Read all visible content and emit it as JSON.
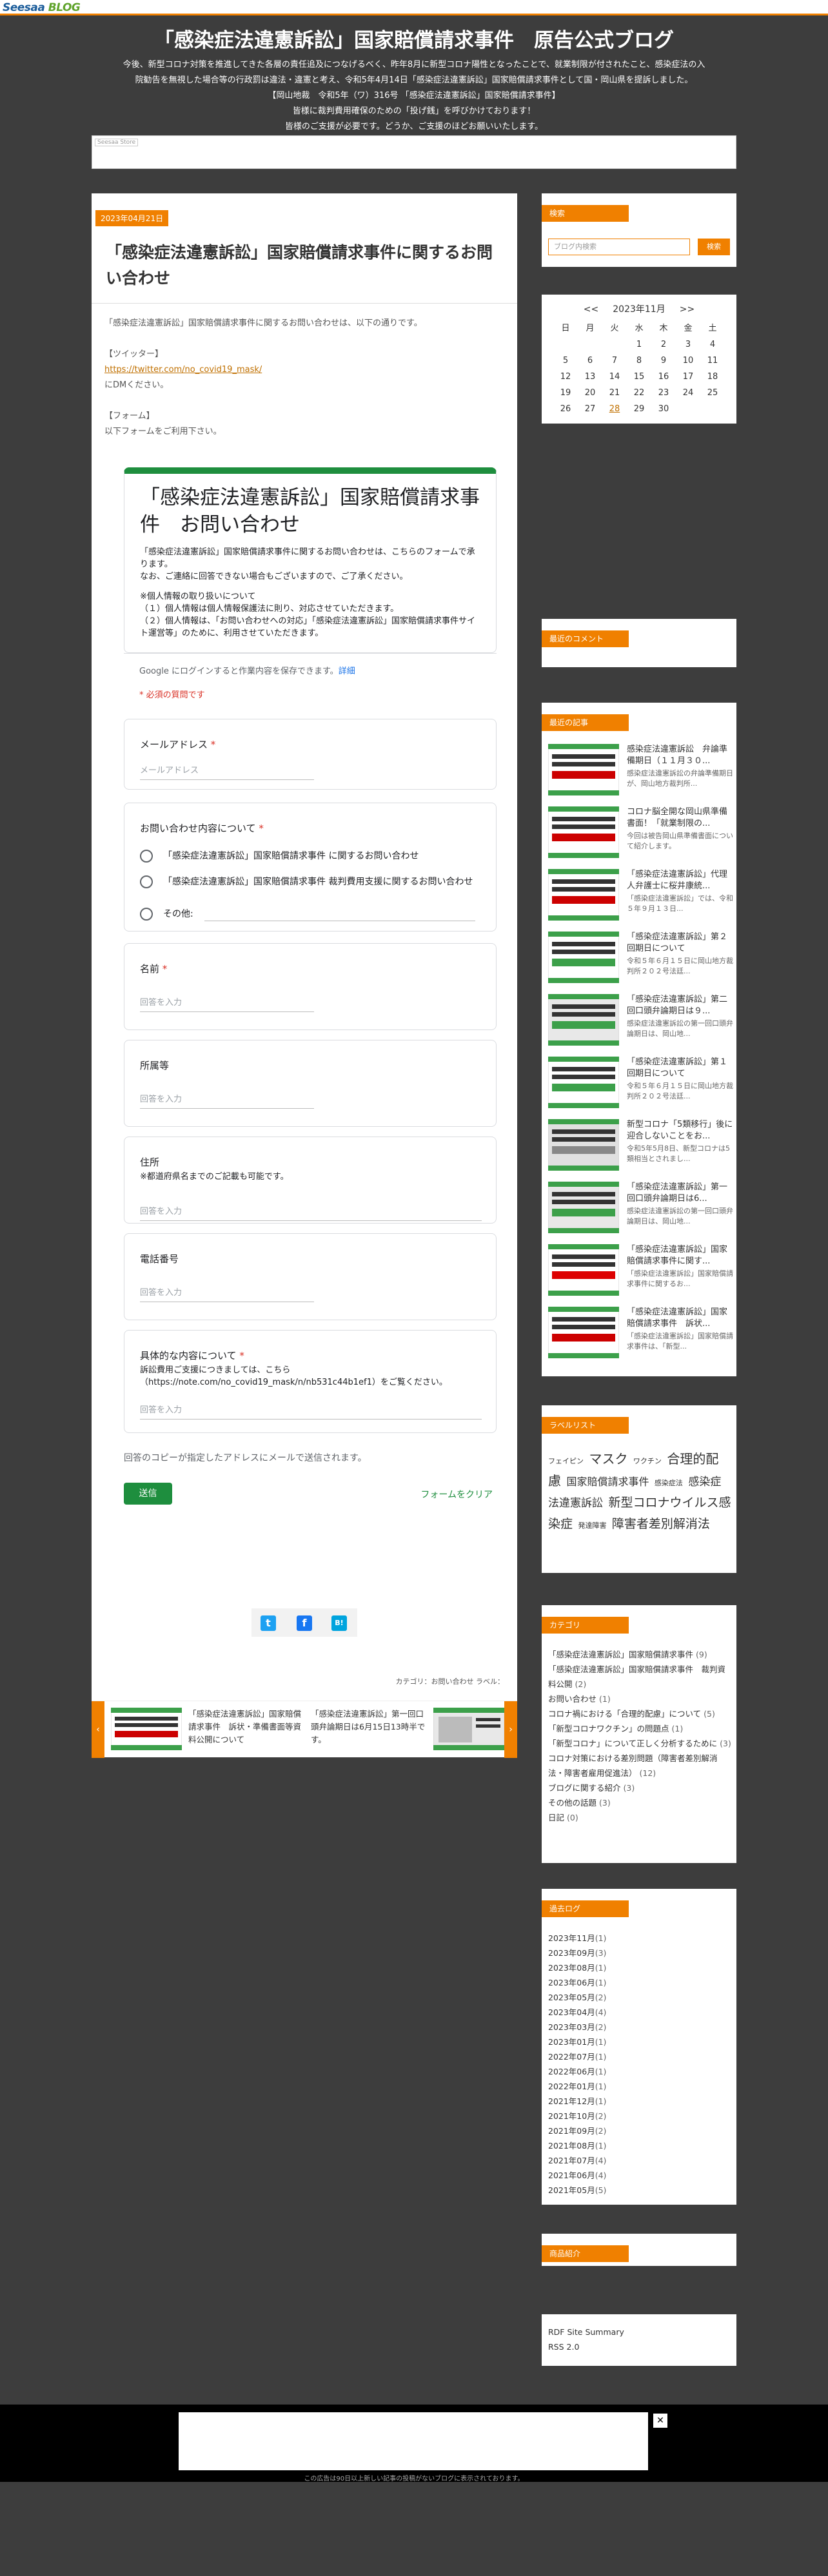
{
  "topbar": {
    "logo_a": "Seesaa",
    "logo_b": "BLOG"
  },
  "header": {
    "title": "「感染症法違憲訴訟」国家賠償請求事件　原告公式ブログ",
    "desc1": "今後、新型コロナ対策を推進してきた各層の責任追及につなげるべく、昨年8月に新型コロナ陽性となったことで、就業制限が付されたこと、感染症法の入",
    "desc2": "院勧告を無視した場合等の行政罰は違法・違憲と考え、令和5年4月14日「感染症法違憲訴訟」国家賠償請求事件として国・岡山県を提訴しました。",
    "desc3": "【岡山地裁　令和5年（ワ）316号 「感染症法違憲訴訟」国家賠償請求事件】",
    "desc4": "皆様に裁判費用確保のための「投げ銭」を呼びかけております！",
    "desc5": "皆様のご支援が必要です。どうか、ご支援のほどお願いいたします。",
    "banner_label": "Seesaa Store"
  },
  "entry": {
    "date": "2023年04月21日",
    "title": "「感染症法違憲訴訟」国家賠償請求事件に関するお問い合わせ",
    "p1": "「感染症法違憲訴訟」国家賠償請求事件に関するお問い合わせは、以下の通りです。",
    "twitter_label": "【ツイッター】",
    "twitter_link": "https://twitter.com/no_covid19_mask/",
    "dm_note": "にDMください。",
    "form_label": "【フォーム】",
    "form_note": "以下フォームをご利用下さい。",
    "category_line": "カテゴリ：お問い合わせ ラベル："
  },
  "form": {
    "title": "「感染症法違憲訴訟」国家賠償請求事件　お問い合わせ",
    "desc1": "「感染症法違憲訴訟」国家賠償請求事件に関するお問い合わせは、こちらのフォームで承ります。",
    "desc2": "なお、ご連絡に回答できない場合もございますので、ご了承ください。",
    "desc3": "※個人情報の取り扱いについて",
    "desc4": "（１）個人情報は個人情報保護法に則り、対応させていただきます。",
    "desc5": "（２）個人情報は、「お問い合わせへの対応」「感染症法違憲訴訟」国家賠償請求事件サイト運営等」のために、利用させていただきます。",
    "login": "Google にログインすると作業内容を保存できます。",
    "login_link": "詳細",
    "required": "* 必須の質問です",
    "email_label": "メールアドレス",
    "email_ph": "メールアドレス",
    "inq_label": "お問い合わせ内容について",
    "opt1": "「感染症法違憲訴訟」国家賠償請求事件 に関するお問い合わせ",
    "opt2": "「感染症法違憲訴訟」国家賠償請求事件 裁判費用支援に関するお問い合わせ",
    "opt3": "その他:",
    "name_label": "名前",
    "answer_ph": "回答を入力",
    "org_label": "所属等",
    "addr_label": "住所",
    "addr_sub": "※都道府県名までのご記載も可能です。",
    "tel_label": "電話番号",
    "detail_label": "具体的な内容について",
    "detail_sub": "訴訟費用ご支援につきましては、こちら（https://note.com/no_covid19_mask/n/nb531c44b1ef1）をご覧ください。",
    "copy_note": "回答のコピーが指定したアドレスにメールで送信されます。",
    "submit": "送信",
    "clear": "フォームをクリア"
  },
  "pager": {
    "prev": "「感染症法違憲訴訟」国家賠償請求事件　訴状・準備書面等資料公開について",
    "next": "「感染症法違憲訴訟」第一回口頭弁論期日は6月15日13時半です。"
  },
  "sidebar": {
    "search_title": "検索",
    "search_ph": "ブログ内検索",
    "search_btn": "検索",
    "cal": {
      "prev": "<<",
      "month": "2023年11月",
      "next": ">>",
      "week": [
        "日",
        "月",
        "火",
        "水",
        "木",
        "金",
        "土"
      ],
      "rows": [
        [
          "",
          "",
          "",
          "1",
          "2",
          "3",
          "4"
        ],
        [
          "5",
          "6",
          "7",
          "8",
          "9",
          "10",
          "11"
        ],
        [
          "12",
          "13",
          "14",
          "15",
          "16",
          "17",
          "18"
        ],
        [
          "19",
          "20",
          "21",
          "22",
          "23",
          "24",
          "25"
        ],
        [
          "26",
          "27",
          "28",
          "29",
          "30",
          "",
          ""
        ]
      ],
      "today": "28"
    },
    "comments_title": "最近のコメント",
    "recent_title": "最近の記事",
    "recent": [
      {
        "title": "感染症法違憲訴訟　弁論準備期日（１１月３０...",
        "ex": "感染症法違憲訴訟の弁論準備期日が、岡山地方裁判所..."
      },
      {
        "title": "コロナ脳全開な岡山県準備書面！「就業制限の...",
        "ex": "今回は被告岡山県準備書面について紹介します。"
      },
      {
        "title": "「感染症法違憲訴訟」代理人弁護士に桜井康統...",
        "ex": "「感染症法違憲訴訟」では、令和５年９月１３日..."
      },
      {
        "title": "「感染症法違憲訴訟」第２回期日について",
        "ex": "令和５年６月１５日に岡山地方裁判所２０２号法廷..."
      },
      {
        "title": "「感染症法違憲訴訟」第二回口頭弁論期日は９...",
        "ex": "感染症法違憲訴訟の第一回口頭弁論期日は、岡山地..."
      },
      {
        "title": "「感染症法違憲訴訟」第１回期日について",
        "ex": "令和５年６月１５日に岡山地方裁判所２０２号法廷..."
      },
      {
        "title": "新型コロナ「5類移行」後に迎合しないことをお...",
        "ex": "令和5年5月8日、新型コロナは5類相当とされまし..."
      },
      {
        "title": "「感染症法違憲訴訟」第一回口頭弁論期日は6...",
        "ex": "感染症法違憲訴訟の第一回口頭弁論期日は、岡山地..."
      },
      {
        "title": "「感染症法違憲訴訟」国家賠償請求事件に関す...",
        "ex": "「感染症法違憲訴訟」国家賠償請求事件に関するお..."
      },
      {
        "title": "「感染症法違憲訴訟」国家賠償請求事件　訴状...",
        "ex": "「感染症法違憲訴訟」国家賠償請求事件は、「新型..."
      }
    ],
    "labels_title": "ラベルリスト",
    "labels": [
      "フェイピン",
      "マスク",
      "ワクチン",
      "合理的配慮",
      "国家賠償請求事件",
      "感染症法",
      "感染症法違憲訴訟",
      "新型コロナウイルス感染症",
      "発達障害",
      "障害者差別解消法"
    ],
    "category_title": "カテゴリ",
    "categories": [
      {
        "name": "「感染症法違憲訴訟」国家賠償請求事件",
        "count": "(9)"
      },
      {
        "name": "「感染症法違憲訴訟」国家賠償請求事件　裁判資料公開",
        "count": "(2)"
      },
      {
        "name": "お問い合わせ",
        "count": "(1)"
      },
      {
        "name": "コロナ禍における「合理的配慮」について",
        "count": "(5)"
      },
      {
        "name": "「新型コロナワクチン」の問題点",
        "count": "(1)"
      },
      {
        "name": "「新型コロナ」について正しく分析するために",
        "count": "(3)"
      },
      {
        "name": "コロナ対策における差別問題（障害者差別解消法・障害者雇用促進法）",
        "count": "(12)"
      },
      {
        "name": "ブログに関する紹介",
        "count": "(3)"
      },
      {
        "name": "その他の話題",
        "count": "(3)"
      },
      {
        "name": "日記",
        "count": "(0)"
      }
    ],
    "archive_title": "過去ログ",
    "archives": [
      {
        "m": "2023年11月",
        "c": "(1)"
      },
      {
        "m": "2023年09月",
        "c": "(3)"
      },
      {
        "m": "2023年08月",
        "c": "(1)"
      },
      {
        "m": "2023年06月",
        "c": "(1)"
      },
      {
        "m": "2023年05月",
        "c": "(2)"
      },
      {
        "m": "2023年04月",
        "c": "(4)"
      },
      {
        "m": "2023年03月",
        "c": "(2)"
      },
      {
        "m": "2023年01月",
        "c": "(1)"
      },
      {
        "m": "2022年07月",
        "c": "(1)"
      },
      {
        "m": "2022年06月",
        "c": "(1)"
      },
      {
        "m": "2022年01月",
        "c": "(1)"
      },
      {
        "m": "2021年12月",
        "c": "(1)"
      },
      {
        "m": "2021年10月",
        "c": "(2)"
      },
      {
        "m": "2021年09月",
        "c": "(2)"
      },
      {
        "m": "2021年08月",
        "c": "(1)"
      },
      {
        "m": "2021年07月",
        "c": "(4)"
      },
      {
        "m": "2021年06月",
        "c": "(4)"
      },
      {
        "m": "2021年05月",
        "c": "(5)"
      }
    ],
    "goods_title": "商品紹介",
    "feed1": "RDF Site Summary",
    "feed2": "RSS 2.0"
  },
  "ad": {
    "close": "✕",
    "note": "この広告は90日以上新しい記事の投稿がないブログに表示されております。"
  }
}
